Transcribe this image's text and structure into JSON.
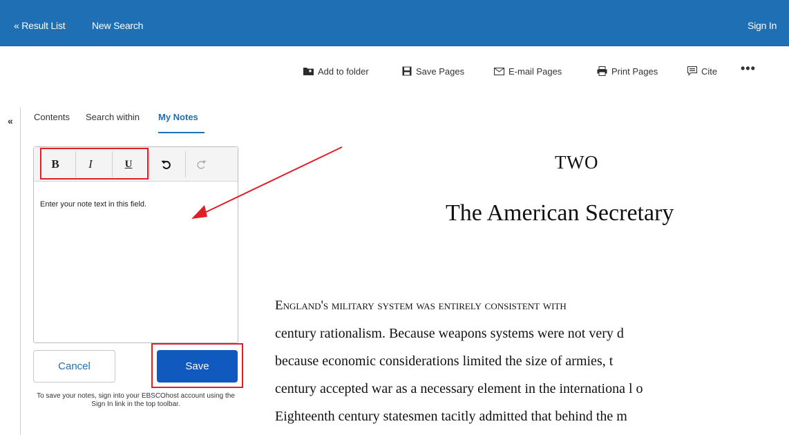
{
  "topbar": {
    "result_list": "« Result List",
    "new_search": "New Search",
    "sign_in": "Sign In"
  },
  "toolbar": {
    "add_to_folder": "Add to folder",
    "save_pages": "Save Pages",
    "email_pages": "E-mail Pages",
    "print_pages": "Print Pages",
    "cite": "Cite",
    "more": "•••"
  },
  "sidebar": {
    "collapse": "«",
    "tabs": [
      {
        "label": "Contents"
      },
      {
        "label": "Search within"
      },
      {
        "label": "My Notes",
        "active": true
      }
    ]
  },
  "notes": {
    "format_buttons": {
      "bold": "B",
      "italic": "I",
      "underline": "U"
    },
    "placeholder_text": "Enter your note text in this field.",
    "cancel_label": "Cancel",
    "save_label": "Save",
    "help_text": "To save your notes, sign into your EBSCOhost account using the Sign In link in the top toolbar."
  },
  "document": {
    "chapter_number": "TWO",
    "chapter_title": "The American Secretary",
    "lines": [
      "century rationalism. Because weapons systems were not very d",
      "because economic considerations limited the size of armies, t",
      "century accepted war as a necessary element in the internationa l o",
      "Eighteenth century statesmen tacitly admitted that behind the m"
    ],
    "first_line": "England's military system was entirely consistent with"
  },
  "colors": {
    "header_blue": "#1f6fb5",
    "save_button": "#1059be",
    "highlight_red": "#e01e26"
  }
}
